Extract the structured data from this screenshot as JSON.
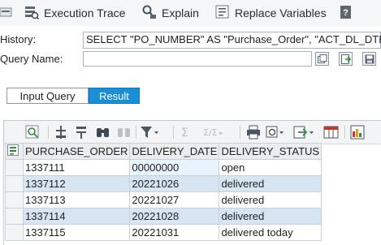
{
  "toolbar": {
    "items": [
      {
        "label": "",
        "icon": "tool-icon"
      },
      {
        "label": "Execution Trace",
        "icon": "execution-trace-icon"
      },
      {
        "label": "Explain",
        "icon": "explain-icon"
      },
      {
        "label": "Replace Variables",
        "icon": "replace-variables-icon"
      },
      {
        "label": "",
        "icon": "help-icon"
      }
    ]
  },
  "history": {
    "label": "History:",
    "value": "SELECT \"PO_NUMBER\" AS \"Purchase_Order\", \"ACT_DL_DTE\" AS \""
  },
  "query_name": {
    "label": "Query Name:",
    "value": ""
  },
  "tabs": [
    {
      "label": "Input Query",
      "active": false
    },
    {
      "label": "Result",
      "active": true
    }
  ],
  "result": {
    "columns": [
      "PURCHASE_ORDER",
      "DELIVERY_DATE",
      "DELIVERY_STATUS"
    ],
    "rows": [
      [
        "1337111",
        "00000000",
        "open"
      ],
      [
        "1337112",
        "20221026",
        "delivered"
      ],
      [
        "1337113",
        "20221027",
        "delivered"
      ],
      [
        "1337114",
        "20221028",
        "delivered"
      ],
      [
        "1337115",
        "20221031",
        "delivered today"
      ]
    ]
  },
  "colors": {
    "accent": "#1a8fd6",
    "row_alt": "#d7e4f2",
    "toolbar_bg": "#f4f6f7"
  }
}
